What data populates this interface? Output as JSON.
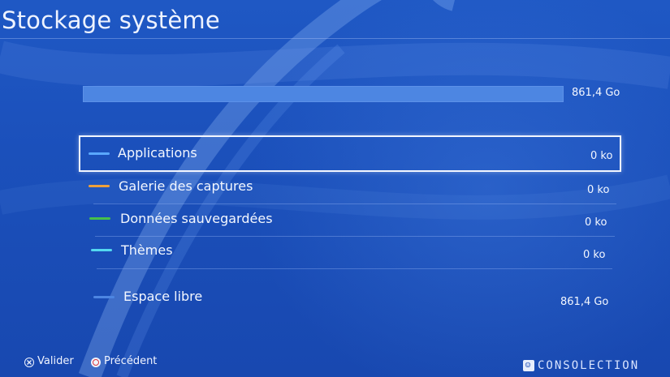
{
  "header": {
    "title": "Stockage système"
  },
  "storage": {
    "total_label": "861,4 Go",
    "used_fraction": 0
  },
  "categories": [
    {
      "label": "Applications",
      "size": "0 ko",
      "color": "#5aa8ff",
      "selected": true
    },
    {
      "label": "Galerie des captures",
      "size": "0 ko",
      "color": "#f0a03a",
      "selected": false
    },
    {
      "label": "Données sauvegardées",
      "size": "0 ko",
      "color": "#46c04a",
      "selected": false
    },
    {
      "label": "Thèmes",
      "size": "0 ko",
      "color": "#54d8f0",
      "selected": false
    },
    {
      "label": "Espace libre",
      "size": "861,4 Go",
      "color": "#4d86e2",
      "selected": false
    }
  ],
  "footer": {
    "confirm": {
      "icon": "cross-button-icon",
      "label": "Valider"
    },
    "back": {
      "icon": "circle-button-icon",
      "label": "Précédent"
    }
  },
  "watermark": {
    "text": "CONSOLECTION"
  },
  "colors": {
    "background": "#1b50bb",
    "accent": "#4d86e2",
    "text": "#ffffff"
  }
}
